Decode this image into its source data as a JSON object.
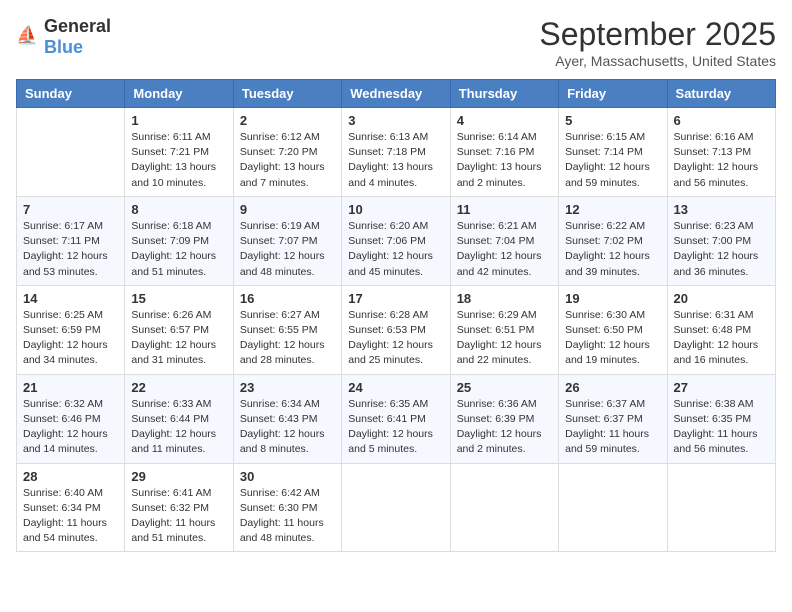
{
  "header": {
    "logo_general": "General",
    "logo_blue": "Blue",
    "month_title": "September 2025",
    "location": "Ayer, Massachusetts, United States"
  },
  "days_of_week": [
    "Sunday",
    "Monday",
    "Tuesday",
    "Wednesday",
    "Thursday",
    "Friday",
    "Saturday"
  ],
  "weeks": [
    [
      {
        "day": "",
        "info": ""
      },
      {
        "day": "1",
        "info": "Sunrise: 6:11 AM\nSunset: 7:21 PM\nDaylight: 13 hours\nand 10 minutes."
      },
      {
        "day": "2",
        "info": "Sunrise: 6:12 AM\nSunset: 7:20 PM\nDaylight: 13 hours\nand 7 minutes."
      },
      {
        "day": "3",
        "info": "Sunrise: 6:13 AM\nSunset: 7:18 PM\nDaylight: 13 hours\nand 4 minutes."
      },
      {
        "day": "4",
        "info": "Sunrise: 6:14 AM\nSunset: 7:16 PM\nDaylight: 13 hours\nand 2 minutes."
      },
      {
        "day": "5",
        "info": "Sunrise: 6:15 AM\nSunset: 7:14 PM\nDaylight: 12 hours\nand 59 minutes."
      },
      {
        "day": "6",
        "info": "Sunrise: 6:16 AM\nSunset: 7:13 PM\nDaylight: 12 hours\nand 56 minutes."
      }
    ],
    [
      {
        "day": "7",
        "info": "Sunrise: 6:17 AM\nSunset: 7:11 PM\nDaylight: 12 hours\nand 53 minutes."
      },
      {
        "day": "8",
        "info": "Sunrise: 6:18 AM\nSunset: 7:09 PM\nDaylight: 12 hours\nand 51 minutes."
      },
      {
        "day": "9",
        "info": "Sunrise: 6:19 AM\nSunset: 7:07 PM\nDaylight: 12 hours\nand 48 minutes."
      },
      {
        "day": "10",
        "info": "Sunrise: 6:20 AM\nSunset: 7:06 PM\nDaylight: 12 hours\nand 45 minutes."
      },
      {
        "day": "11",
        "info": "Sunrise: 6:21 AM\nSunset: 7:04 PM\nDaylight: 12 hours\nand 42 minutes."
      },
      {
        "day": "12",
        "info": "Sunrise: 6:22 AM\nSunset: 7:02 PM\nDaylight: 12 hours\nand 39 minutes."
      },
      {
        "day": "13",
        "info": "Sunrise: 6:23 AM\nSunset: 7:00 PM\nDaylight: 12 hours\nand 36 minutes."
      }
    ],
    [
      {
        "day": "14",
        "info": "Sunrise: 6:25 AM\nSunset: 6:59 PM\nDaylight: 12 hours\nand 34 minutes."
      },
      {
        "day": "15",
        "info": "Sunrise: 6:26 AM\nSunset: 6:57 PM\nDaylight: 12 hours\nand 31 minutes."
      },
      {
        "day": "16",
        "info": "Sunrise: 6:27 AM\nSunset: 6:55 PM\nDaylight: 12 hours\nand 28 minutes."
      },
      {
        "day": "17",
        "info": "Sunrise: 6:28 AM\nSunset: 6:53 PM\nDaylight: 12 hours\nand 25 minutes."
      },
      {
        "day": "18",
        "info": "Sunrise: 6:29 AM\nSunset: 6:51 PM\nDaylight: 12 hours\nand 22 minutes."
      },
      {
        "day": "19",
        "info": "Sunrise: 6:30 AM\nSunset: 6:50 PM\nDaylight: 12 hours\nand 19 minutes."
      },
      {
        "day": "20",
        "info": "Sunrise: 6:31 AM\nSunset: 6:48 PM\nDaylight: 12 hours\nand 16 minutes."
      }
    ],
    [
      {
        "day": "21",
        "info": "Sunrise: 6:32 AM\nSunset: 6:46 PM\nDaylight: 12 hours\nand 14 minutes."
      },
      {
        "day": "22",
        "info": "Sunrise: 6:33 AM\nSunset: 6:44 PM\nDaylight: 12 hours\nand 11 minutes."
      },
      {
        "day": "23",
        "info": "Sunrise: 6:34 AM\nSunset: 6:43 PM\nDaylight: 12 hours\nand 8 minutes."
      },
      {
        "day": "24",
        "info": "Sunrise: 6:35 AM\nSunset: 6:41 PM\nDaylight: 12 hours\nand 5 minutes."
      },
      {
        "day": "25",
        "info": "Sunrise: 6:36 AM\nSunset: 6:39 PM\nDaylight: 12 hours\nand 2 minutes."
      },
      {
        "day": "26",
        "info": "Sunrise: 6:37 AM\nSunset: 6:37 PM\nDaylight: 11 hours\nand 59 minutes."
      },
      {
        "day": "27",
        "info": "Sunrise: 6:38 AM\nSunset: 6:35 PM\nDaylight: 11 hours\nand 56 minutes."
      }
    ],
    [
      {
        "day": "28",
        "info": "Sunrise: 6:40 AM\nSunset: 6:34 PM\nDaylight: 11 hours\nand 54 minutes."
      },
      {
        "day": "29",
        "info": "Sunrise: 6:41 AM\nSunset: 6:32 PM\nDaylight: 11 hours\nand 51 minutes."
      },
      {
        "day": "30",
        "info": "Sunrise: 6:42 AM\nSunset: 6:30 PM\nDaylight: 11 hours\nand 48 minutes."
      },
      {
        "day": "",
        "info": ""
      },
      {
        "day": "",
        "info": ""
      },
      {
        "day": "",
        "info": ""
      },
      {
        "day": "",
        "info": ""
      }
    ]
  ]
}
